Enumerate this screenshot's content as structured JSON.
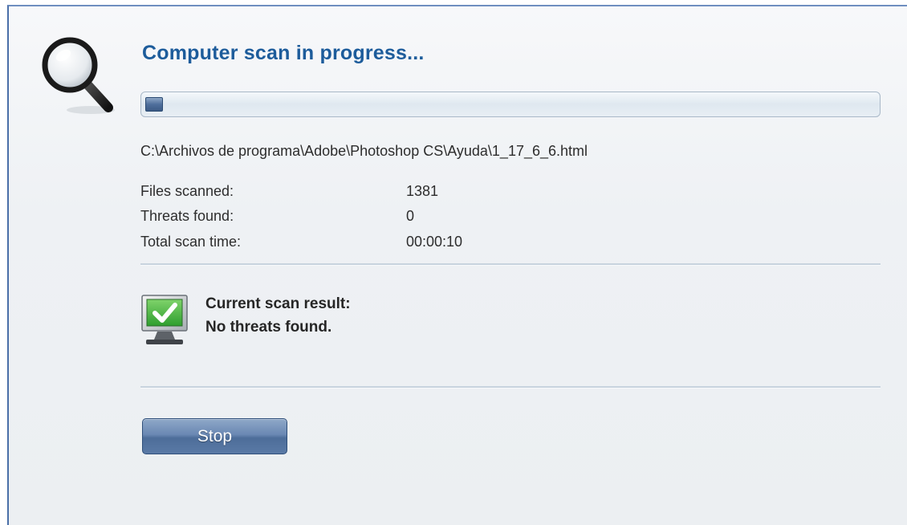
{
  "scan": {
    "title": "Computer scan in progress...",
    "progress_fraction": 0.02,
    "current_file": "C:\\Archivos de programa\\Adobe\\Photoshop CS\\Ayuda\\1_17_6_6.html"
  },
  "stats": {
    "files_scanned_label": "Files scanned:",
    "files_scanned_value": "1381",
    "threats_found_label": "Threats found:",
    "threats_found_value": "0",
    "total_time_label": "Total scan time:",
    "total_time_value": "00:00:10"
  },
  "result": {
    "heading": "Current scan result:",
    "status": "No threats found.",
    "status_color": "#2e9e2e"
  },
  "actions": {
    "stop_label": "Stop"
  },
  "colors": {
    "title": "#1d5c9b",
    "button": "#5a7aa6"
  }
}
